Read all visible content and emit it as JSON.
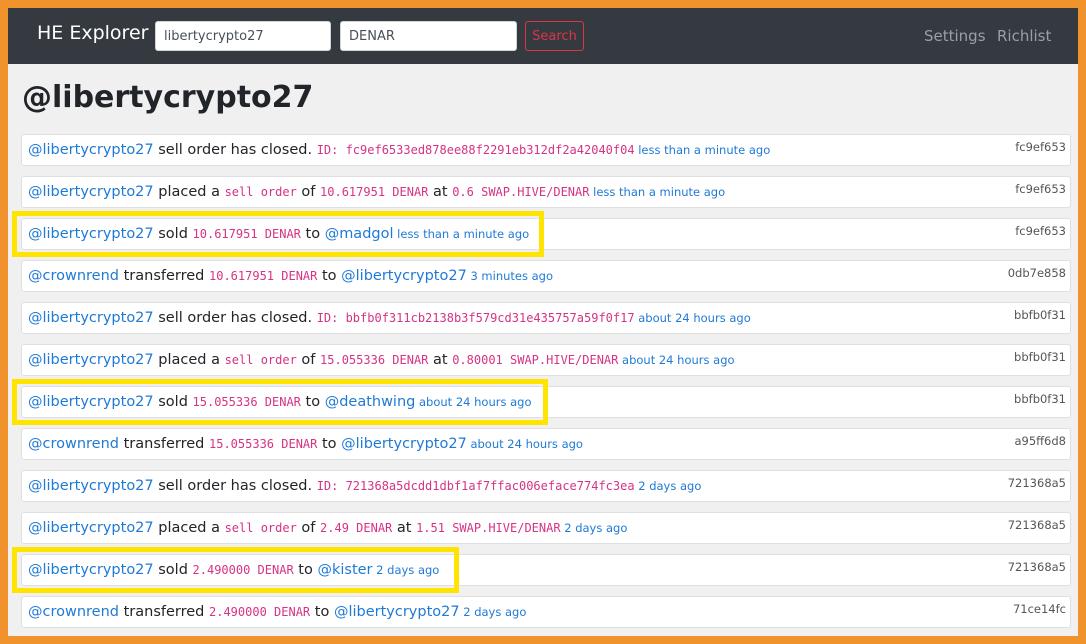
{
  "header": {
    "brand": "HE Explorer",
    "account_input_value": "libertycrypto27",
    "token_input_value": "DENAR",
    "search_label": "Search",
    "nav_links": [
      "Settings",
      "Richlist"
    ]
  },
  "page_title": "@libertycrypto27",
  "rows": [
    {
      "segments": [
        {
          "t": "@libertycrypto27",
          "s": "link"
        },
        {
          "t": " sell order has closed. ",
          "s": "text"
        },
        {
          "t": "ID: fc9ef6533ed878ee88f2291eb312df2a42040f04",
          "s": "code"
        },
        {
          "t": " less than a minute ago",
          "s": "time"
        }
      ],
      "hash": "fc9ef653"
    },
    {
      "segments": [
        {
          "t": "@libertycrypto27",
          "s": "link"
        },
        {
          "t": " placed a ",
          "s": "text"
        },
        {
          "t": "sell order",
          "s": "code"
        },
        {
          "t": " of ",
          "s": "text"
        },
        {
          "t": "10.617951 DENAR",
          "s": "code"
        },
        {
          "t": " at ",
          "s": "text"
        },
        {
          "t": "0.6 SWAP.HIVE/DENAR",
          "s": "code"
        },
        {
          "t": " less than a minute ago",
          "s": "time"
        }
      ],
      "hash": "fc9ef653"
    },
    {
      "segments": [
        {
          "t": "@libertycrypto27",
          "s": "link"
        },
        {
          "t": " sold ",
          "s": "text"
        },
        {
          "t": "10.617951 DENAR",
          "s": "code"
        },
        {
          "t": " to ",
          "s": "text"
        },
        {
          "t": "@madgol",
          "s": "link"
        },
        {
          "t": " less than a minute ago",
          "s": "time"
        }
      ],
      "hash": "fc9ef653"
    },
    {
      "segments": [
        {
          "t": "@crownrend",
          "s": "link"
        },
        {
          "t": " transferred ",
          "s": "text"
        },
        {
          "t": "10.617951 DENAR",
          "s": "code"
        },
        {
          "t": " to ",
          "s": "text"
        },
        {
          "t": "@libertycrypto27",
          "s": "link"
        },
        {
          "t": " 3 minutes ago",
          "s": "time"
        }
      ],
      "hash": "0db7e858"
    },
    {
      "segments": [
        {
          "t": "@libertycrypto27",
          "s": "link"
        },
        {
          "t": " sell order has closed. ",
          "s": "text"
        },
        {
          "t": "ID: bbfb0f311cb2138b3f579cd31e435757a59f0f17",
          "s": "code"
        },
        {
          "t": " about 24 hours ago",
          "s": "time"
        }
      ],
      "hash": "bbfb0f31"
    },
    {
      "segments": [
        {
          "t": "@libertycrypto27",
          "s": "link"
        },
        {
          "t": " placed a ",
          "s": "text"
        },
        {
          "t": "sell order",
          "s": "code"
        },
        {
          "t": " of ",
          "s": "text"
        },
        {
          "t": "15.055336 DENAR",
          "s": "code"
        },
        {
          "t": " at ",
          "s": "text"
        },
        {
          "t": "0.80001 SWAP.HIVE/DENAR",
          "s": "code"
        },
        {
          "t": " about 24 hours ago",
          "s": "time"
        }
      ],
      "hash": "bbfb0f31"
    },
    {
      "segments": [
        {
          "t": "@libertycrypto27",
          "s": "link"
        },
        {
          "t": " sold ",
          "s": "text"
        },
        {
          "t": "15.055336 DENAR",
          "s": "code"
        },
        {
          "t": " to ",
          "s": "text"
        },
        {
          "t": "@deathwing",
          "s": "link"
        },
        {
          "t": " about 24 hours ago",
          "s": "time"
        }
      ],
      "hash": "bbfb0f31"
    },
    {
      "segments": [
        {
          "t": "@crownrend",
          "s": "link"
        },
        {
          "t": " transferred ",
          "s": "text"
        },
        {
          "t": "15.055336 DENAR",
          "s": "code"
        },
        {
          "t": " to ",
          "s": "text"
        },
        {
          "t": "@libertycrypto27",
          "s": "link"
        },
        {
          "t": " about 24 hours ago",
          "s": "time"
        }
      ],
      "hash": "a95ff6d8"
    },
    {
      "segments": [
        {
          "t": "@libertycrypto27",
          "s": "link"
        },
        {
          "t": " sell order has closed. ",
          "s": "text"
        },
        {
          "t": "ID: 721368a5dcdd1dbf1af7ffac006eface774fc3ea",
          "s": "code"
        },
        {
          "t": " 2 days ago",
          "s": "time"
        }
      ],
      "hash": "721368a5"
    },
    {
      "segments": [
        {
          "t": "@libertycrypto27",
          "s": "link"
        },
        {
          "t": " placed a ",
          "s": "text"
        },
        {
          "t": "sell order",
          "s": "code"
        },
        {
          "t": " of ",
          "s": "text"
        },
        {
          "t": "2.49 DENAR",
          "s": "code"
        },
        {
          "t": " at ",
          "s": "text"
        },
        {
          "t": "1.51 SWAP.HIVE/DENAR",
          "s": "code"
        },
        {
          "t": " 2 days ago",
          "s": "time"
        }
      ],
      "hash": "721368a5"
    },
    {
      "segments": [
        {
          "t": "@libertycrypto27",
          "s": "link"
        },
        {
          "t": " sold ",
          "s": "text"
        },
        {
          "t": "2.490000 DENAR",
          "s": "code"
        },
        {
          "t": " to ",
          "s": "text"
        },
        {
          "t": "@kister",
          "s": "link"
        },
        {
          "t": " 2 days ago",
          "s": "time"
        }
      ],
      "hash": "721368a5"
    },
    {
      "segments": [
        {
          "t": "@crownrend",
          "s": "link"
        },
        {
          "t": " transferred ",
          "s": "text"
        },
        {
          "t": "2.490000 DENAR",
          "s": "code"
        },
        {
          "t": " to ",
          "s": "text"
        },
        {
          "t": "@libertycrypto27",
          "s": "link"
        },
        {
          "t": " 2 days ago",
          "s": "time"
        }
      ],
      "hash": "71ce14fc"
    }
  ],
  "highlighted_rows": [
    2,
    6,
    10
  ],
  "colors": {
    "highlight": "#ffe400",
    "link": "#1f7ad6",
    "code": "#d63384",
    "outer_border": "#f0932c"
  }
}
